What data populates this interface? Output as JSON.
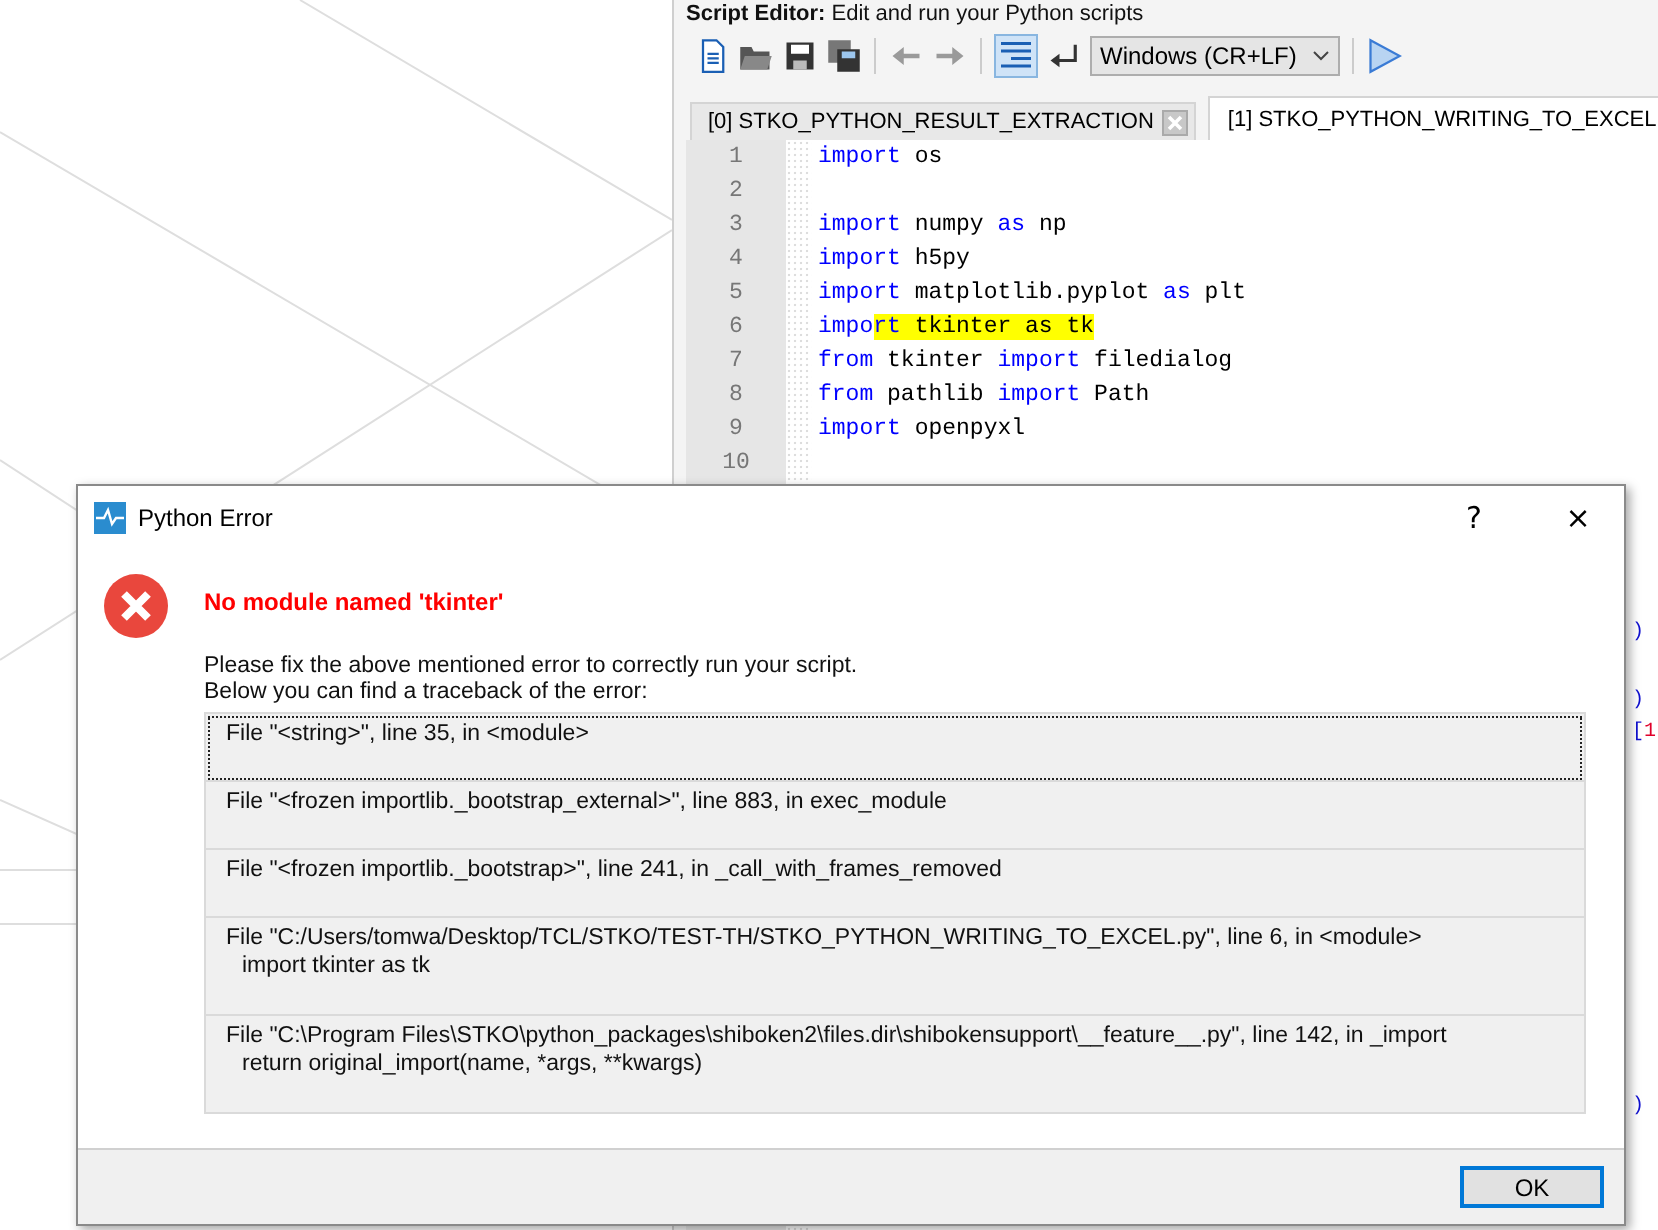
{
  "editor": {
    "title": "Script Editor:",
    "subtitle": "Edit and run your Python scripts",
    "toolbar": {
      "navigation_disabled": true,
      "line_wrap_on": true,
      "line_ending": "Windows (CR+LF)"
    },
    "tabs": [
      {
        "label": "[0] STKO_PYTHON_RESULT_EXTRACTION",
        "selected": false
      },
      {
        "label": "[1] STKO_PYTHON_WRITING_TO_EXCEL",
        "selected": true
      }
    ],
    "lines": [
      {
        "number": "1",
        "tokens": [
          {
            "text": "import",
            "kind": "keyword"
          },
          {
            "text": " os",
            "kind": "name"
          }
        ]
      },
      {
        "number": "2"
      },
      {
        "number": "3",
        "tokens": [
          {
            "text": "import",
            "kind": "keyword"
          },
          {
            "text": " numpy ",
            "kind": "name"
          },
          {
            "text": "as",
            "kind": "keyword"
          },
          {
            "text": " np",
            "kind": "name"
          }
        ]
      },
      {
        "number": "4",
        "tokens": [
          {
            "text": "import",
            "kind": "keyword"
          },
          {
            "text": " h5py",
            "kind": "name"
          }
        ]
      },
      {
        "number": "5",
        "tokens": [
          {
            "text": "import",
            "kind": "keyword"
          },
          {
            "text": " matplotlib.pyplot ",
            "kind": "name"
          },
          {
            "text": "as",
            "kind": "keyword"
          },
          {
            "text": " plt",
            "kind": "name"
          }
        ]
      },
      {
        "number": "6",
        "tokens": [
          {
            "text": "impo",
            "kind": "keyword"
          },
          {
            "text": "rt",
            "kind": "markedkeyword"
          },
          {
            "text": " tkinter as tk",
            "kind": "marked"
          }
        ]
      },
      {
        "number": "7",
        "tokens": [
          {
            "text": "from",
            "kind": "keyword"
          },
          {
            "text": " tkinter ",
            "kind": "name"
          },
          {
            "text": "import",
            "kind": "keyword"
          },
          {
            "text": " filedialog",
            "kind": "name"
          }
        ]
      },
      {
        "number": "8",
        "tokens": [
          {
            "text": "from",
            "kind": "keyword"
          },
          {
            "text": " pathlib ",
            "kind": "name"
          },
          {
            "text": "import",
            "kind": "keyword"
          },
          {
            "text": " Path",
            "kind": "name"
          }
        ]
      },
      {
        "number": "9",
        "tokens": [
          {
            "text": "import",
            "kind": "keyword"
          },
          {
            "text": " openpyxl",
            "kind": "name"
          }
        ]
      },
      {
        "number": "10"
      }
    ],
    "hidden_line_ends": [
      {
        "tokens": [
          {
            "text": ")",
            "kind": "bracket"
          }
        ]
      },
      {
        "tokens": [
          {
            "text": ")",
            "kind": "bracket"
          }
        ]
      },
      {
        "tokens": [
          {
            "text": "[",
            "kind": "bracket"
          },
          {
            "text": "1",
            "kind": "number"
          }
        ]
      },
      {
        "tokens": [
          {
            "text": ")",
            "kind": "bracket"
          }
        ]
      }
    ]
  },
  "dialog": {
    "title": "Python Error",
    "help": "?",
    "close": "×",
    "error": "No module named 'tkinter'",
    "message": [
      "Please fix the above mentioned error to correctly run your script.",
      "Below you can find a traceback of the error:"
    ],
    "traceback": [
      {
        "text": "File \"<string>\", line 35, in <module>",
        "selected": true
      },
      {
        "text": "File \"<frozen importlib._bootstrap_external>\", line 883, in exec_module",
        "selected": false
      },
      {
        "text": "File \"<frozen importlib._bootstrap>\", line 241, in _call_with_frames_removed",
        "selected": false
      },
      {
        "text": "File \"C:/Users/tomwa/Desktop/TCL/STKO/TEST-TH/STKO_PYTHON_WRITING_TO_EXCEL.py\", line 6, in <module>",
        "code": "import tkinter as tk",
        "selected": false
      },
      {
        "text": "File \"C:\\Program Files\\STKO\\python_packages\\shiboken2\\files.dir\\shibokensupport\\__feature__.py\", line 142, in _import",
        "code": "return original_import(name, *args, **kwargs)",
        "selected": false
      }
    ],
    "ok": "OK"
  }
}
